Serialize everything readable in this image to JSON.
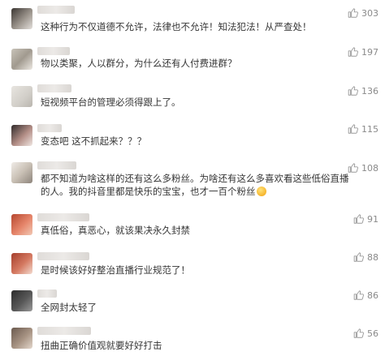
{
  "comments": [
    {
      "text": "这种行为不仅道德不允许，法律也不允许！知法犯法！从严查处！",
      "likes": "303"
    },
    {
      "text": "物以类聚，人以群分，为什么还有人付费进群？",
      "likes": "197"
    },
    {
      "text": "短视频平台的管理必须得跟上了。",
      "likes": "136"
    },
    {
      "text": "变态吧 这不抓起来？？？",
      "likes": "115"
    },
    {
      "text": "都不知道为啥这样的还有这么多粉丝。为啥还有这么多喜欢看这些低俗直播的人。我的抖音里都是快乐的宝宝，也才一百个粉丝",
      "likes": "108"
    },
    {
      "text": "真低俗，真恶心，就该果决永久封禁",
      "likes": "91"
    },
    {
      "text": "是时候该好好整治直播行业规范了！",
      "likes": "88"
    },
    {
      "text": "全网封太轻了",
      "likes": "86"
    },
    {
      "text": "扭曲正确价值观就要好好打击",
      "likes": "56"
    }
  ],
  "icons": {
    "like": "thumbs-up-icon",
    "emoji": "laughing-emoji-icon"
  },
  "colors": {
    "like_icon": "#9a9a9a",
    "text": "#353535",
    "count": "#8a8a8a"
  }
}
